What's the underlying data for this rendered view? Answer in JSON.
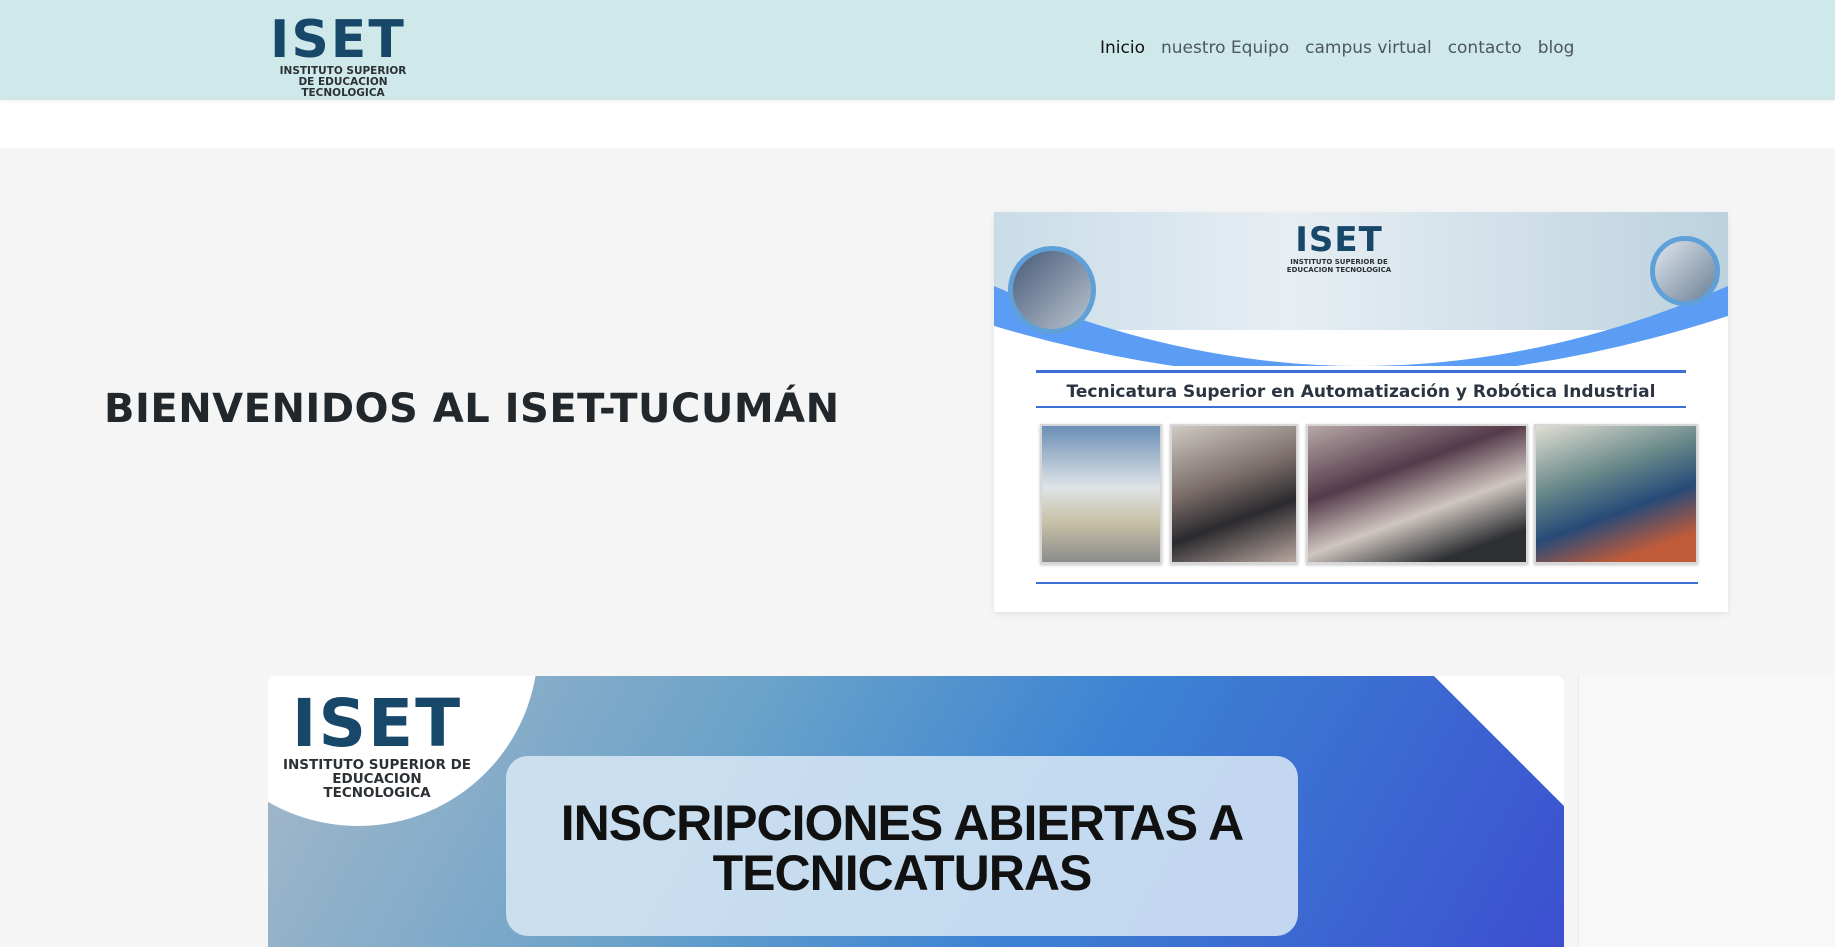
{
  "header": {
    "logo": {
      "big": "ISET",
      "small": "INSTITUTO SUPERIOR DE EDUCACION TECNOLOGICA"
    },
    "nav": [
      {
        "label": "Inicio",
        "active": true
      },
      {
        "label": "nuestro Equipo",
        "active": false
      },
      {
        "label": "campus virtual",
        "active": false
      },
      {
        "label": "contacto",
        "active": false
      },
      {
        "label": "blog",
        "active": false
      }
    ]
  },
  "hero": {
    "title": "BIENVENIDOS AL ISET-TUCUMÁN",
    "flyer": {
      "brand_big": "ISET",
      "brand_small": "INSTITUTO SUPERIOR DE EDUCACION TECNOLOGICA",
      "subtitle": "Tecnicatura Superior en  Automatización y Robótica Industrial"
    }
  },
  "banner": {
    "brand_big": "ISET",
    "brand_small": "INSTITUTO SUPERIOR DE EDUCACION TECNOLOGICA",
    "headline": "INSCRIPCIONES ABIERTAS A TECNICATURAS"
  },
  "colors": {
    "header_bg": "#cfe9eb",
    "brand_blue": "#17486a",
    "accent_blue": "#3d6ed2"
  }
}
